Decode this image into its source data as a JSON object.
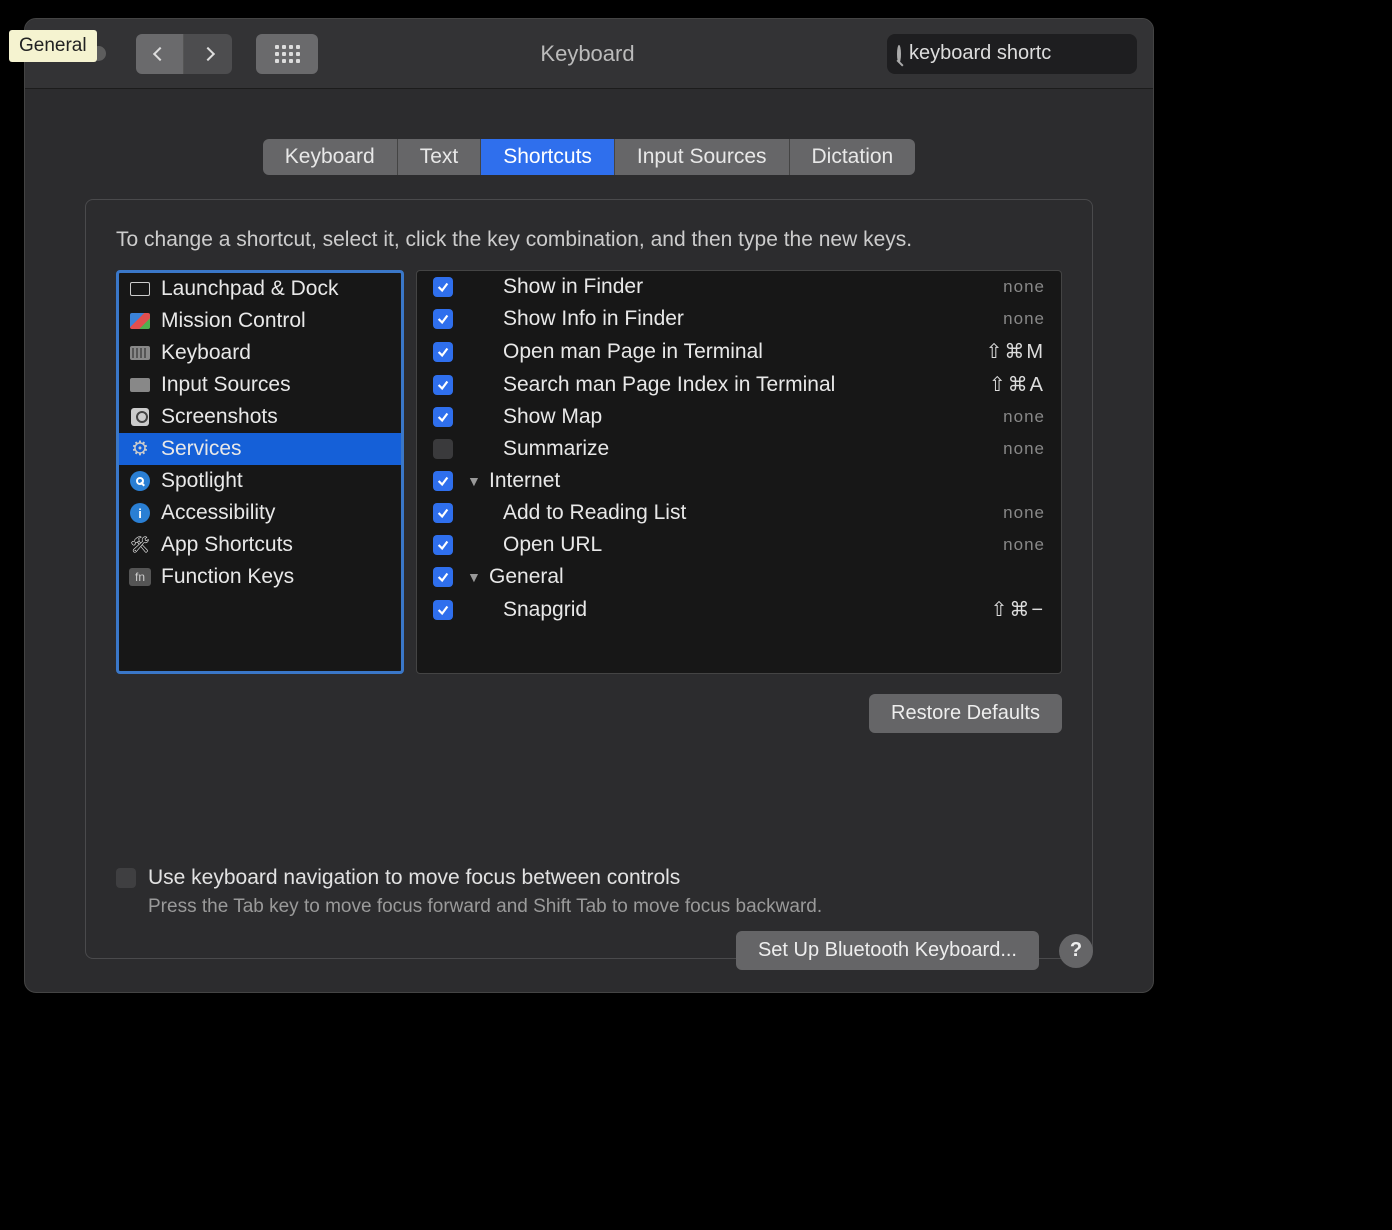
{
  "tooltip": "General",
  "window_title": "Keyboard",
  "search": {
    "value": "keyboard shortc"
  },
  "tabs": [
    "Keyboard",
    "Text",
    "Shortcuts",
    "Input Sources",
    "Dictation"
  ],
  "active_tab": 2,
  "instruction": "To change a shortcut, select it, click the key combination, and then type the new keys.",
  "categories": [
    {
      "label": "Launchpad & Dock",
      "icon": "rect"
    },
    {
      "label": "Mission Control",
      "icon": "mc"
    },
    {
      "label": "Keyboard",
      "icon": "kb"
    },
    {
      "label": "Input Sources",
      "icon": "is"
    },
    {
      "label": "Screenshots",
      "icon": "ss"
    },
    {
      "label": "Services",
      "icon": "gear",
      "selected": true
    },
    {
      "label": "Spotlight",
      "icon": "spot"
    },
    {
      "label": "Accessibility",
      "icon": "acc"
    },
    {
      "label": "App Shortcuts",
      "icon": "app"
    },
    {
      "label": "Function Keys",
      "icon": "fn"
    }
  ],
  "services": [
    {
      "checked": true,
      "label": "Show in Finder",
      "key": "none",
      "indent": true
    },
    {
      "checked": true,
      "label": "Show Info in Finder",
      "key": "none",
      "indent": true
    },
    {
      "checked": true,
      "label": "Open man Page in Terminal",
      "key": "⇧⌘M",
      "indent": true
    },
    {
      "checked": true,
      "label": "Search man Page Index in Terminal",
      "key": "⇧⌘A",
      "indent": true
    },
    {
      "checked": true,
      "label": "Show Map",
      "key": "none",
      "indent": true
    },
    {
      "checked": false,
      "label": "Summarize",
      "key": "none",
      "indent": true
    },
    {
      "checked": true,
      "label": "Internet",
      "group": true
    },
    {
      "checked": true,
      "label": "Add to Reading List",
      "key": "none",
      "indent": true
    },
    {
      "checked": true,
      "label": "Open URL",
      "key": "none",
      "indent": true
    },
    {
      "checked": true,
      "label": "General",
      "group": true
    },
    {
      "checked": true,
      "label": "Snapgrid",
      "key": "⇧⌘−",
      "indent": true
    }
  ],
  "restore_label": "Restore Defaults",
  "nav_checkbox_label": "Use keyboard navigation to move focus between controls",
  "nav_sub": "Press the Tab key to move focus forward and Shift Tab to move focus backward.",
  "bluetooth_label": "Set Up Bluetooth Keyboard...",
  "help_label": "?"
}
